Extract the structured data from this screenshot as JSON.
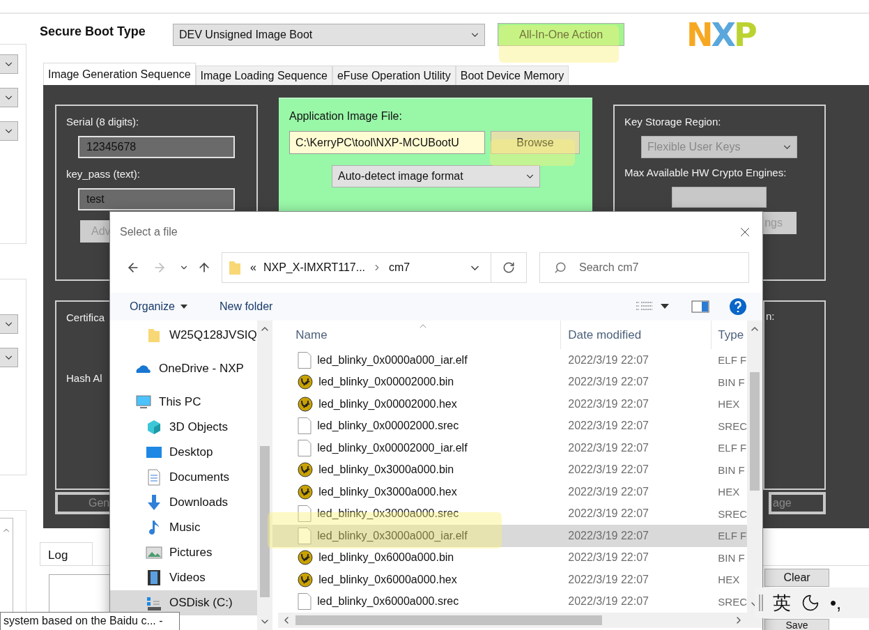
{
  "header": {
    "label": "Secure Boot Type",
    "boot_type": "DEV Unsigned Image Boot",
    "action_button": "All-In-One Action",
    "logo": "NXP"
  },
  "tabs": [
    {
      "label": "Image Generation Sequence",
      "selected": true
    },
    {
      "label": "Image Loading Sequence",
      "selected": false
    },
    {
      "label": "eFuse Operation Utility",
      "selected": false
    },
    {
      "label": "Boot Device Memory",
      "selected": false
    }
  ],
  "generation": {
    "serial": {
      "label": "Serial (8 digits):",
      "value": "12345678"
    },
    "key_pass": {
      "label": "key_pass (text):",
      "value": "test"
    },
    "advanced_button": {
      "label": "Adv",
      "disabled": true
    },
    "app_image": {
      "label": "Application Image File:",
      "path": "C:\\KerryPC\\tool\\NXP-MCUBootU",
      "browse": "Browse",
      "format": "Auto-detect image format"
    },
    "key_storage": {
      "label": "Key Storage Region:",
      "value": "Flexible User Keys",
      "disabled": true
    },
    "crypto": {
      "label": "Max Available HW Crypto Engines:"
    },
    "settings_button": {
      "label": "ngs",
      "disabled": true
    },
    "certificate_label": "Certifica",
    "hash_label": "Hash Al",
    "right_label": "n:",
    "generate_button": "Gen",
    "image_button": "age"
  },
  "log": {
    "tab": "Log",
    "clear": "Clear",
    "save": "Save"
  },
  "dialog": {
    "title": "Select a file",
    "path_prefix": "«",
    "path": [
      "NXP_X-IMXRT117...",
      "cm7"
    ],
    "search_placeholder": "Search cm7",
    "organize": "Organize",
    "new_folder": "New folder",
    "nav": [
      {
        "label": "W25Q128JVSIQ",
        "kind": "folder",
        "selected": false
      },
      {
        "label": "OneDrive - NXP",
        "kind": "cloud",
        "selected": false
      },
      {
        "label": "This PC",
        "kind": "pc",
        "selected": false,
        "children": [
          {
            "label": "3D Objects",
            "kind": "cube",
            "selected": false
          },
          {
            "label": "Desktop",
            "kind": "desktop",
            "selected": false
          },
          {
            "label": "Documents",
            "kind": "document",
            "selected": false
          },
          {
            "label": "Downloads",
            "kind": "download",
            "selected": false
          },
          {
            "label": "Music",
            "kind": "music",
            "selected": false
          },
          {
            "label": "Pictures",
            "kind": "picture",
            "selected": false
          },
          {
            "label": "Videos",
            "kind": "video",
            "selected": false
          },
          {
            "label": "OSDisk (C:)",
            "kind": "disk",
            "selected": true
          }
        ]
      }
    ],
    "columns": [
      "Name",
      "Date modified",
      "Type"
    ],
    "files": [
      {
        "name": "led_blinky_0x0000a000_iar.elf",
        "kind": "blank",
        "date": "2022/3/19 22:07",
        "type": "ELF F",
        "selected": false
      },
      {
        "name": "led_blinky_0x00002000.bin",
        "kind": "app",
        "date": "2022/3/19 22:07",
        "type": "BIN F",
        "selected": false
      },
      {
        "name": "led_blinky_0x00002000.hex",
        "kind": "app",
        "date": "2022/3/19 22:07",
        "type": "HEX",
        "selected": false
      },
      {
        "name": "led_blinky_0x00002000.srec",
        "kind": "blank",
        "date": "2022/3/19 22:07",
        "type": "SREC",
        "selected": false
      },
      {
        "name": "led_blinky_0x00002000_iar.elf",
        "kind": "blank",
        "date": "2022/3/19 22:07",
        "type": "ELF F",
        "selected": false
      },
      {
        "name": "led_blinky_0x3000a000.bin",
        "kind": "app",
        "date": "2022/3/19 22:07",
        "type": "BIN F",
        "selected": false
      },
      {
        "name": "led_blinky_0x3000a000.hex",
        "kind": "app",
        "date": "2022/3/19 22:07",
        "type": "HEX",
        "selected": false
      },
      {
        "name": "led_blinky_0x3000a000.srec",
        "kind": "blank",
        "date": "2022/3/19 22:07",
        "type": "SREC",
        "selected": false
      },
      {
        "name": "led_blinky_0x3000a000_iar.elf",
        "kind": "blank",
        "date": "2022/3/19 22:07",
        "type": "ELF F",
        "selected": true
      },
      {
        "name": "led_blinky_0x6000a000.bin",
        "kind": "app",
        "date": "2022/3/19 22:07",
        "type": "BIN F",
        "selected": false
      },
      {
        "name": "led_blinky_0x6000a000.hex",
        "kind": "app",
        "date": "2022/3/19 22:07",
        "type": "HEX",
        "selected": false
      },
      {
        "name": "led_blinky_0x6000a000.srec",
        "kind": "blank",
        "date": "2022/3/19 22:07",
        "type": "SREC",
        "selected": false
      }
    ]
  },
  "tooltip": "system based on the Baidu c... -",
  "ime": {
    "mode": "英",
    "punctuation": "•,"
  }
}
